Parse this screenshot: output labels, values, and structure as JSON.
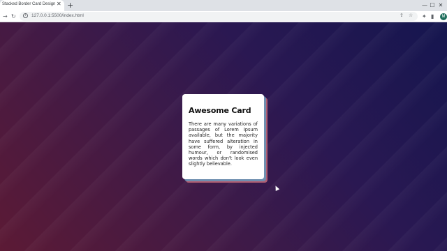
{
  "browser": {
    "tab_title": "Stacked Border Card Design",
    "tab_close": "✕",
    "new_tab": "+",
    "url": "127.0.0.1:5500/index.html",
    "avatar_letter": "M",
    "minimize": "—",
    "maximize": "☐",
    "close": "✕",
    "back": "←",
    "forward": "→",
    "reload": "↻",
    "info": "i",
    "share": "⇪",
    "bookmark": "☆",
    "extensions": "✦",
    "sidebar": "▮"
  },
  "card": {
    "title": "Awesome Card",
    "body": "There are many variations of passages of Lorem Ipsum available, but the majority have suffered alteration in some form, by injected humour, or randomised words which don't look even slightly believable."
  },
  "colors": {
    "gradient_left": "#5c1a35",
    "gradient_right": "#15164f",
    "stack_blue": "#6f8fb0",
    "stack_red": "#b05f73"
  }
}
